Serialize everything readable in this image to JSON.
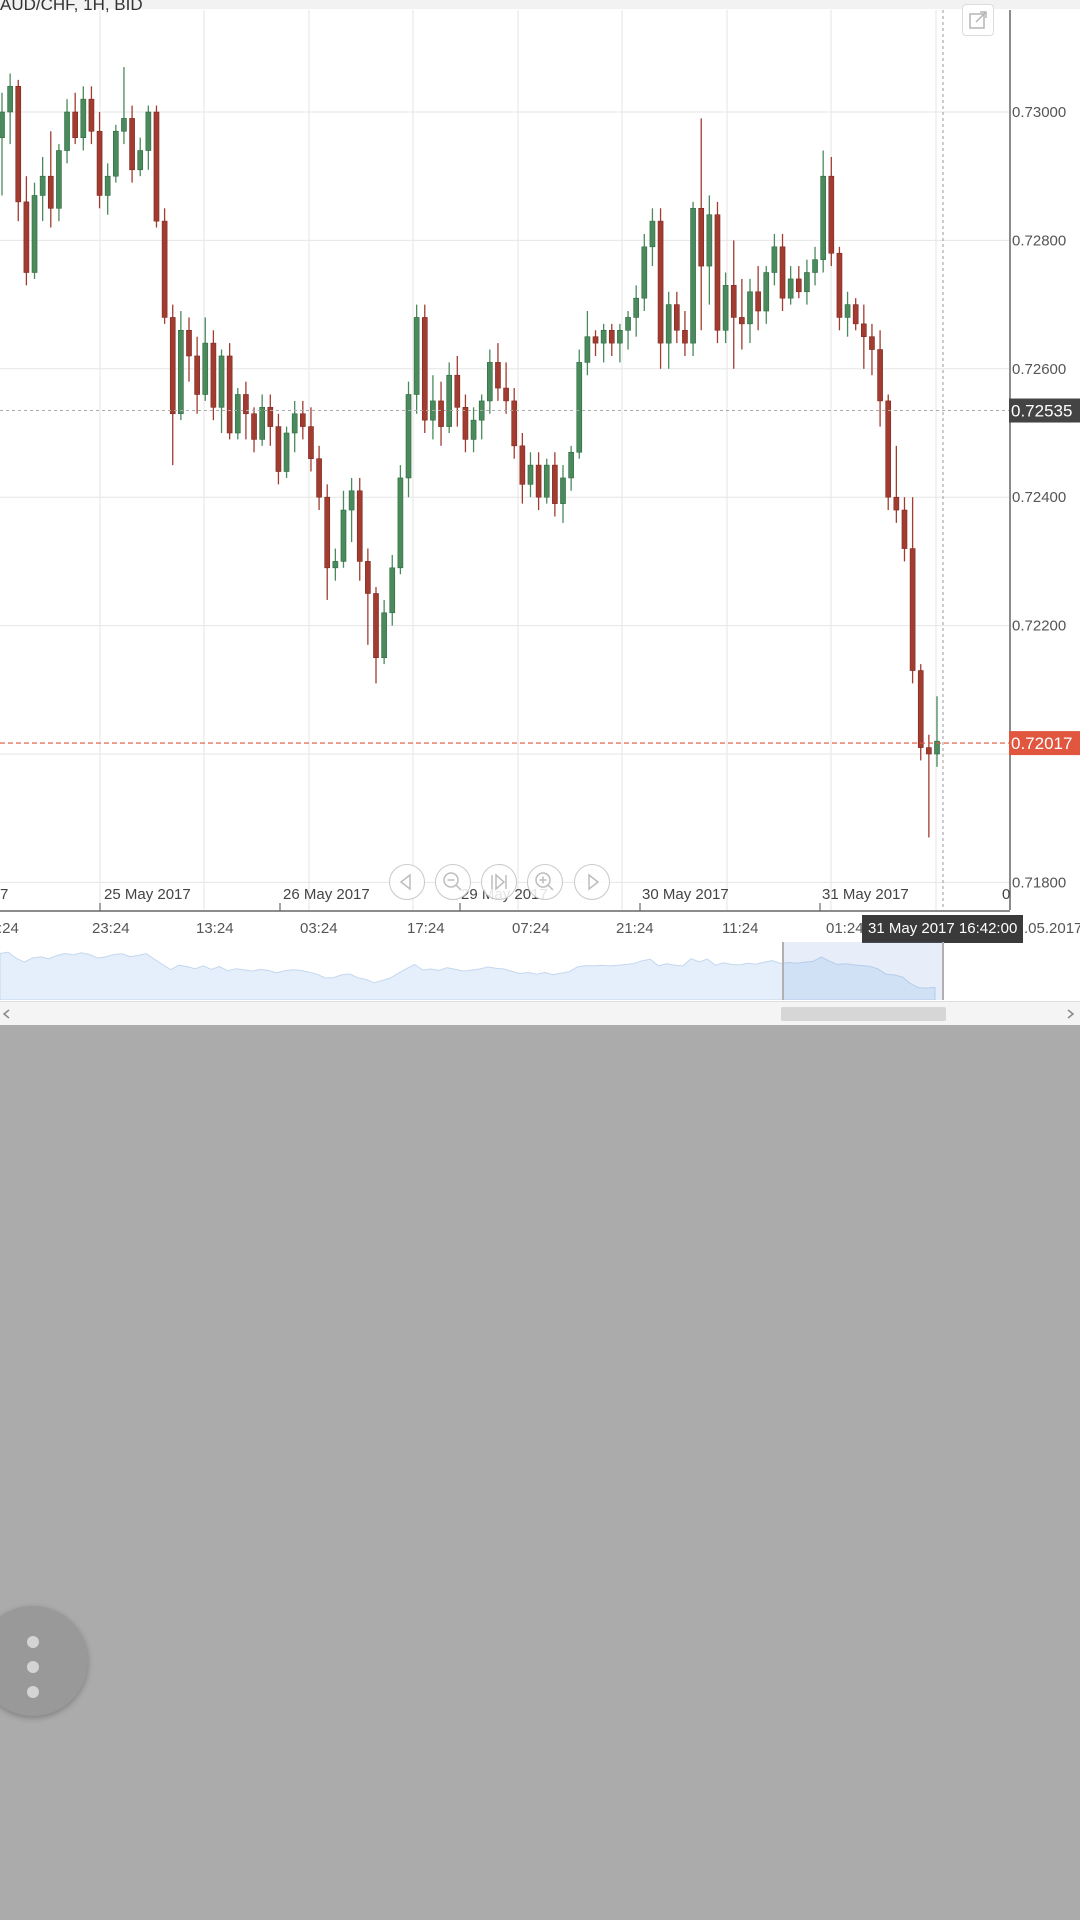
{
  "chart_title": "AUD/CHF, 1H, BID",
  "colors": {
    "up": "#4a8a5c",
    "down": "#a23b30",
    "current_price": "#e0563f",
    "crosshair_price_bg": "#444444",
    "grid": "#e6e6e6"
  },
  "icons": {
    "popout": "external-window-icon",
    "nav_prev": "triangle-left-icon",
    "zoom_out": "zoom-out-icon",
    "reset": "skip-to-end-icon",
    "zoom_in": "zoom-in-icon",
    "nav_next": "triangle-right-icon",
    "fab": "vertical-dots-icon"
  },
  "chart_data": {
    "type": "candlestick",
    "title": "AUD/CHF, 1H, BID",
    "y_axis": {
      "ticks": [
        "0.73000",
        "0.72800",
        "0.72600",
        "0.72400",
        "0.72200",
        "0.71800"
      ],
      "tick_values": [
        0.73,
        0.728,
        0.726,
        0.724,
        0.722,
        0.718
      ],
      "range": [
        0.7178,
        0.7316
      ],
      "crosshair_price": "0.72535",
      "current_price": "0.72017"
    },
    "date_labels": [
      "7",
      "25 May 2017",
      "26 May 2017",
      "29 May 2017",
      "30 May 2017",
      "31 May 2017",
      "0"
    ],
    "time_labels": [
      ":24",
      "23:24",
      "13:24",
      "03:24",
      "17:24",
      "07:24",
      "21:24",
      "11:24",
      "01:24",
      ".05.2017"
    ],
    "crosshair_time": "31 May 2017 16:42:00",
    "candles": [
      [
        0.7296,
        0.7303,
        0.7287,
        0.73
      ],
      [
        0.73,
        0.7306,
        0.7295,
        0.7304
      ],
      [
        0.7304,
        0.7305,
        0.7283,
        0.7286
      ],
      [
        0.7286,
        0.729,
        0.7273,
        0.7275
      ],
      [
        0.7275,
        0.7289,
        0.7274,
        0.7287
      ],
      [
        0.7287,
        0.7293,
        0.7283,
        0.729
      ],
      [
        0.729,
        0.7297,
        0.7282,
        0.7285
      ],
      [
        0.7285,
        0.7295,
        0.7283,
        0.7294
      ],
      [
        0.7294,
        0.7302,
        0.7292,
        0.73
      ],
      [
        0.73,
        0.7303,
        0.7295,
        0.7296
      ],
      [
        0.7296,
        0.7304,
        0.7294,
        0.7302
      ],
      [
        0.7302,
        0.7304,
        0.7295,
        0.7297
      ],
      [
        0.7297,
        0.73,
        0.7285,
        0.7287
      ],
      [
        0.7287,
        0.7292,
        0.7284,
        0.729
      ],
      [
        0.729,
        0.7298,
        0.7289,
        0.7297
      ],
      [
        0.7297,
        0.7307,
        0.7295,
        0.7299
      ],
      [
        0.7299,
        0.7301,
        0.7289,
        0.7291
      ],
      [
        0.7291,
        0.7296,
        0.729,
        0.7294
      ],
      [
        0.7294,
        0.7301,
        0.7291,
        0.73
      ],
      [
        0.73,
        0.7301,
        0.7282,
        0.7283
      ],
      [
        0.7283,
        0.7285,
        0.7267,
        0.7268
      ],
      [
        0.7268,
        0.727,
        0.7245,
        0.7253
      ],
      [
        0.7253,
        0.7269,
        0.7252,
        0.7266
      ],
      [
        0.7266,
        0.7268,
        0.7258,
        0.7262
      ],
      [
        0.7262,
        0.7265,
        0.7253,
        0.7256
      ],
      [
        0.7256,
        0.7268,
        0.7255,
        0.7264
      ],
      [
        0.7264,
        0.7266,
        0.7252,
        0.7254
      ],
      [
        0.7254,
        0.7263,
        0.725,
        0.7262
      ],
      [
        0.7262,
        0.7264,
        0.7249,
        0.725
      ],
      [
        0.725,
        0.7257,
        0.7249,
        0.7256
      ],
      [
        0.7256,
        0.7258,
        0.7249,
        0.7253
      ],
      [
        0.7253,
        0.7254,
        0.7247,
        0.7249
      ],
      [
        0.7249,
        0.7256,
        0.7248,
        0.7254
      ],
      [
        0.7254,
        0.7256,
        0.7248,
        0.7251
      ],
      [
        0.7251,
        0.7253,
        0.7242,
        0.7244
      ],
      [
        0.7244,
        0.7251,
        0.7243,
        0.725
      ],
      [
        0.725,
        0.7255,
        0.7247,
        0.7253
      ],
      [
        0.7253,
        0.7255,
        0.7249,
        0.7251
      ],
      [
        0.7251,
        0.7254,
        0.7244,
        0.7246
      ],
      [
        0.7246,
        0.7248,
        0.7238,
        0.724
      ],
      [
        0.724,
        0.7242,
        0.7224,
        0.7229
      ],
      [
        0.7229,
        0.7232,
        0.7227,
        0.723
      ],
      [
        0.723,
        0.7241,
        0.7229,
        0.7238
      ],
      [
        0.7238,
        0.7243,
        0.7233,
        0.7241
      ],
      [
        0.7241,
        0.7243,
        0.7227,
        0.723
      ],
      [
        0.723,
        0.7232,
        0.7217,
        0.7225
      ],
      [
        0.7225,
        0.7226,
        0.7211,
        0.7215
      ],
      [
        0.7215,
        0.7224,
        0.7214,
        0.7222
      ],
      [
        0.7222,
        0.7231,
        0.722,
        0.7229
      ],
      [
        0.7229,
        0.7245,
        0.7228,
        0.7243
      ],
      [
        0.7243,
        0.7258,
        0.724,
        0.7256
      ],
      [
        0.7256,
        0.727,
        0.7253,
        0.7268
      ],
      [
        0.7268,
        0.727,
        0.725,
        0.7252
      ],
      [
        0.7252,
        0.7259,
        0.7249,
        0.7255
      ],
      [
        0.7255,
        0.7258,
        0.7248,
        0.7251
      ],
      [
        0.7251,
        0.7261,
        0.725,
        0.7259
      ],
      [
        0.7259,
        0.7262,
        0.7251,
        0.7254
      ],
      [
        0.7254,
        0.7256,
        0.7247,
        0.7249
      ],
      [
        0.7249,
        0.7254,
        0.7247,
        0.7252
      ],
      [
        0.7252,
        0.7256,
        0.7249,
        0.7255
      ],
      [
        0.7255,
        0.7263,
        0.7253,
        0.7261
      ],
      [
        0.7261,
        0.7264,
        0.7255,
        0.7257
      ],
      [
        0.7257,
        0.7261,
        0.7253,
        0.7255
      ],
      [
        0.7255,
        0.7257,
        0.7246,
        0.7248
      ],
      [
        0.7248,
        0.725,
        0.7239,
        0.7242
      ],
      [
        0.7242,
        0.7247,
        0.724,
        0.7245
      ],
      [
        0.7245,
        0.7247,
        0.7238,
        0.724
      ],
      [
        0.724,
        0.7246,
        0.7239,
        0.7245
      ],
      [
        0.7245,
        0.7247,
        0.7237,
        0.7239
      ],
      [
        0.7239,
        0.7245,
        0.7236,
        0.7243
      ],
      [
        0.7243,
        0.7248,
        0.7241,
        0.7247
      ],
      [
        0.7247,
        0.7263,
        0.7246,
        0.7261
      ],
      [
        0.7261,
        0.7269,
        0.7259,
        0.7265
      ],
      [
        0.7265,
        0.7266,
        0.7262,
        0.7264
      ],
      [
        0.7264,
        0.7267,
        0.7261,
        0.7266
      ],
      [
        0.7266,
        0.7267,
        0.7262,
        0.7264
      ],
      [
        0.7264,
        0.7267,
        0.7261,
        0.7266
      ],
      [
        0.7266,
        0.7269,
        0.7263,
        0.7268
      ],
      [
        0.7268,
        0.7273,
        0.7265,
        0.7271
      ],
      [
        0.7271,
        0.7281,
        0.7269,
        0.7279
      ],
      [
        0.7279,
        0.7285,
        0.7276,
        0.7283
      ],
      [
        0.7283,
        0.7285,
        0.726,
        0.7264
      ],
      [
        0.7264,
        0.7272,
        0.726,
        0.727
      ],
      [
        0.727,
        0.7272,
        0.7264,
        0.7266
      ],
      [
        0.7266,
        0.7269,
        0.7262,
        0.7264
      ],
      [
        0.7264,
        0.7286,
        0.7262,
        0.7285
      ],
      [
        0.7285,
        0.7299,
        0.7266,
        0.7276
      ],
      [
        0.7276,
        0.7287,
        0.727,
        0.7284
      ],
      [
        0.7284,
        0.7286,
        0.7264,
        0.7266
      ],
      [
        0.7266,
        0.7275,
        0.7264,
        0.7273
      ],
      [
        0.7273,
        0.728,
        0.726,
        0.7268
      ],
      [
        0.7268,
        0.7274,
        0.7263,
        0.7267
      ],
      [
        0.7267,
        0.7274,
        0.7264,
        0.7272
      ],
      [
        0.7272,
        0.7276,
        0.7266,
        0.7269
      ],
      [
        0.7269,
        0.7276,
        0.7267,
        0.7275
      ],
      [
        0.7275,
        0.7281,
        0.7273,
        0.7279
      ],
      [
        0.7279,
        0.7281,
        0.7269,
        0.7271
      ],
      [
        0.7271,
        0.7276,
        0.727,
        0.7274
      ],
      [
        0.7274,
        0.7276,
        0.7271,
        0.7272
      ],
      [
        0.7272,
        0.7277,
        0.727,
        0.7275
      ],
      [
        0.7275,
        0.7279,
        0.7273,
        0.7277
      ],
      [
        0.7277,
        0.7294,
        0.7275,
        0.729
      ],
      [
        0.729,
        0.7293,
        0.7276,
        0.7278
      ],
      [
        0.7278,
        0.7279,
        0.7266,
        0.7268
      ],
      [
        0.7268,
        0.7272,
        0.7265,
        0.727
      ],
      [
        0.727,
        0.7271,
        0.7266,
        0.7267
      ],
      [
        0.7267,
        0.727,
        0.726,
        0.7265
      ],
      [
        0.7265,
        0.7267,
        0.7259,
        0.7263
      ],
      [
        0.7263,
        0.7266,
        0.7251,
        0.7255
      ],
      [
        0.7255,
        0.7256,
        0.7238,
        0.724
      ],
      [
        0.724,
        0.7248,
        0.7236,
        0.7238
      ],
      [
        0.7238,
        0.724,
        0.723,
        0.7232
      ],
      [
        0.7232,
        0.724,
        0.7211,
        0.7213
      ],
      [
        0.7213,
        0.7214,
        0.7199,
        0.7201
      ],
      [
        0.7201,
        0.7203,
        0.7187,
        0.72
      ],
      [
        0.72,
        0.7209,
        0.7198,
        0.7202
      ]
    ]
  },
  "nav_controls": {
    "prev": "previous",
    "zoom_out": "zoom out",
    "reset": "reset",
    "zoom_in": "zoom in",
    "next": "next"
  }
}
